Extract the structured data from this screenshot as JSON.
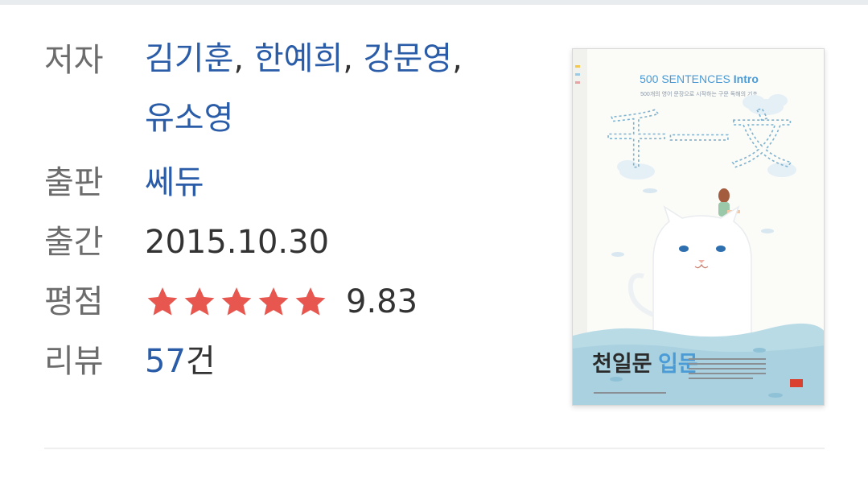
{
  "labels": {
    "author": "저자",
    "publisher": "출판",
    "date": "출간",
    "rating": "평점",
    "review": "리뷰"
  },
  "authors": [
    "김기훈",
    "한예희",
    "강문영",
    "유소영"
  ],
  "publisher": "쎄듀",
  "pub_date": "2015.10.30",
  "rating": {
    "value": "9.83",
    "stars": 5,
    "star_color": "#e8574f"
  },
  "review": {
    "count": "57",
    "unit": "건"
  },
  "cover": {
    "series": "500 SENTENCES",
    "series_emph": "Intro",
    "tagline": "500개의 영어 문장으로 시작하는 구문 독해의 기초",
    "big_title": "千一文",
    "title_a": "천일문",
    "title_b": "입문",
    "accent_color": "#4a9bd6"
  },
  "colors": {
    "link": "#2a5ca8",
    "label": "#6c6c6c",
    "text": "#333333"
  }
}
